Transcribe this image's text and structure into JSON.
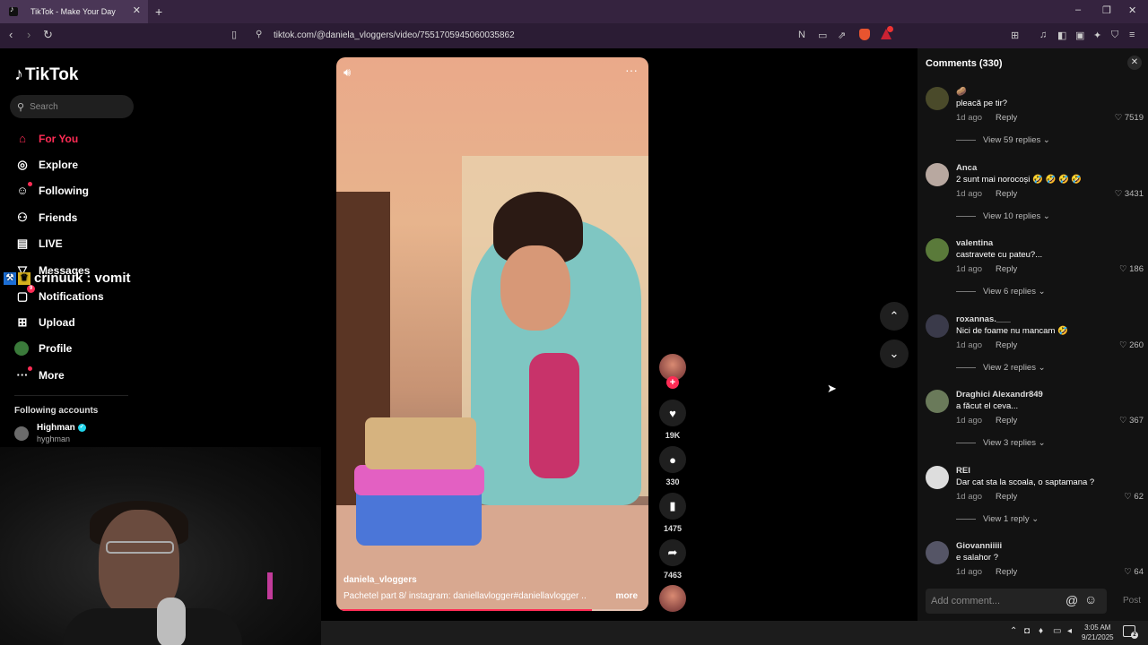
{
  "browser": {
    "tab_title": "TikTok - Make Your Day",
    "url": "tiktok.com/@daniela_vloggers/video/7551705945060035862"
  },
  "sidebar": {
    "logo": "TikTok",
    "search_placeholder": "Search",
    "nav": [
      {
        "label": "For You",
        "icon": "home-icon"
      },
      {
        "label": "Explore",
        "icon": "compass-icon"
      },
      {
        "label": "Following",
        "icon": "following-icon"
      },
      {
        "label": "Friends",
        "icon": "friends-icon"
      },
      {
        "label": "LIVE",
        "icon": "live-icon"
      },
      {
        "label": "Messages",
        "icon": "messages-icon"
      },
      {
        "label": "Notifications",
        "icon": "notifications-icon",
        "badge": "9"
      },
      {
        "label": "Upload",
        "icon": "upload-icon"
      },
      {
        "label": "Profile",
        "icon": "profile-icon"
      },
      {
        "label": "More",
        "icon": "more-icon"
      }
    ],
    "following_header": "Following accounts",
    "following": [
      {
        "name": "Highman",
        "handle": "hyghman"
      }
    ]
  },
  "overlay": {
    "user": "crinuuk",
    "message": ": vomit"
  },
  "video": {
    "author": "daniela_vloggers",
    "caption": "Pachetel part 8/ instagram: daniellavlogger#daniellavlogger ...",
    "more": "more",
    "progress": 0.82
  },
  "actions": {
    "likes": "19K",
    "comments": "330",
    "saves": "1475",
    "shares": "7463"
  },
  "comments_panel": {
    "title": "Comments (330)",
    "items": [
      {
        "name": "🥔",
        "text": "pleacă pe tir?",
        "time": "1d ago",
        "reply": "Reply",
        "likes": "7519",
        "view": "View 59 replies"
      },
      {
        "name": "Anca",
        "text": "2 sunt mai norocoși 🤣 🤣 🤣 🤣",
        "time": "1d ago",
        "reply": "Reply",
        "likes": "3431",
        "view": "View 10 replies"
      },
      {
        "name": "valentina",
        "text": "castravete cu pateu?...",
        "time": "1d ago",
        "reply": "Reply",
        "likes": "186",
        "view": "View 6 replies"
      },
      {
        "name": "roxannas.___",
        "text": "Nici de foame nu mancam 🤣",
        "time": "1d ago",
        "reply": "Reply",
        "likes": "260",
        "view": "View 2 replies"
      },
      {
        "name": "Draghici Alexandr849",
        "text": "a făcut el ceva...",
        "time": "1d ago",
        "reply": "Reply",
        "likes": "367",
        "view": "View 3 replies"
      },
      {
        "name": "REI",
        "text": "Dar cat sta la scoala, o saptamana ?",
        "time": "1d ago",
        "reply": "Reply",
        "likes": "62",
        "view": "View 1 reply"
      },
      {
        "name": "Giovanniiiii",
        "text": "e salahor ?",
        "time": "1d ago",
        "reply": "Reply",
        "likes": "64",
        "view": ""
      }
    ],
    "input_placeholder": "Add comment...",
    "post": "Post"
  },
  "taskbar": {
    "time": "3:05 AM",
    "date": "9/21/2025",
    "notif_count": "2"
  },
  "colors": {
    "accent": "#fe2c55",
    "panel": "#121212",
    "chrome": "#35233f"
  }
}
